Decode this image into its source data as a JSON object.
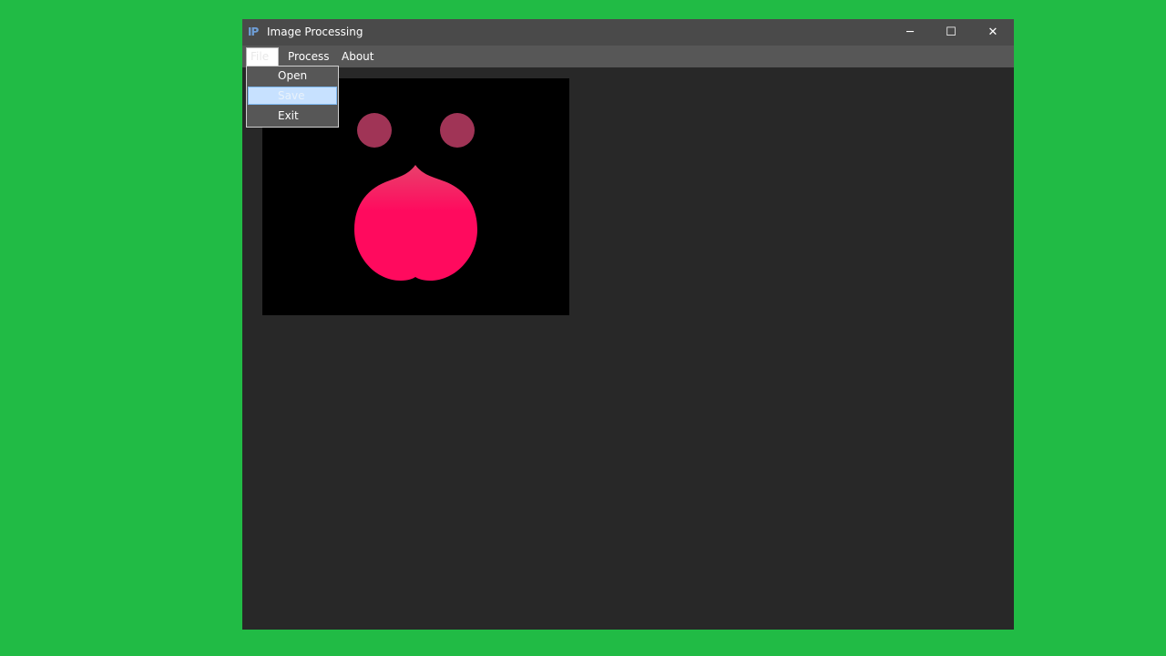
{
  "window": {
    "title": "Image Processing",
    "icon": "IP",
    "icon_name": "app-logo-icon",
    "controls": {
      "minimize": "─",
      "maximize": "☐",
      "close": "✕"
    }
  },
  "menubar": {
    "file_label": "File",
    "process_label": "Process",
    "about_label": "About"
  },
  "file_menu": {
    "items": [
      "Open",
      "Save",
      "Exit"
    ],
    "highlighted": "Save"
  },
  "colors": {
    "desktop": "#21bb45",
    "window_bg": "#282828",
    "titlebar": "#4a4a4a",
    "menubar": "#575757",
    "highlight": "#c7e1ff",
    "shape_main": "#ff0a5e",
    "shape_eyes": "#a03456"
  }
}
